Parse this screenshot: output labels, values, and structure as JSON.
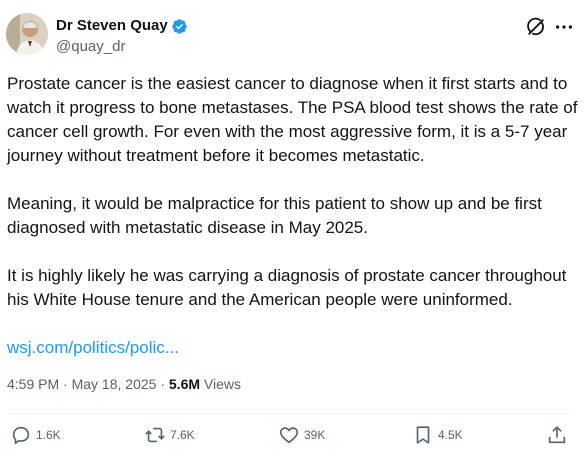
{
  "author": {
    "display_name": "Dr Steven Quay",
    "handle": "@quay_dr",
    "verified": true,
    "avatar_icon": "profile-photo"
  },
  "header_actions": {
    "grok_icon": "grok-icon",
    "more_icon": "more-icon"
  },
  "tweet": {
    "paragraphs": [
      "Prostate cancer is the easiest cancer to diagnose when it first starts and to watch it progress to bone metastases. The PSA blood test shows the rate of cancer cell growth. For even with the most aggressive form, it is a 5-7 year journey without treatment before it becomes metastatic.",
      "Meaning, it would be malpractice for this patient to show up and be first diagnosed with metastatic disease in May 2025.",
      "It is highly likely he was carrying a diagnosis of prostate cancer throughout his White House tenure and the American people were uninformed."
    ],
    "link_text": "wsj.com/politics/polic..."
  },
  "meta": {
    "time": "4:59 PM",
    "date": "May 18, 2025",
    "separator": "·",
    "views_count": "5.6M",
    "views_label": "Views"
  },
  "actions": {
    "replies": "1.6K",
    "reposts": "7.6K",
    "likes": "39K",
    "bookmarks": "4.5K"
  },
  "colors": {
    "accent": "#1d9bf0",
    "text": "#0f1419",
    "muted": "#536471",
    "divider": "#eff3f4"
  }
}
